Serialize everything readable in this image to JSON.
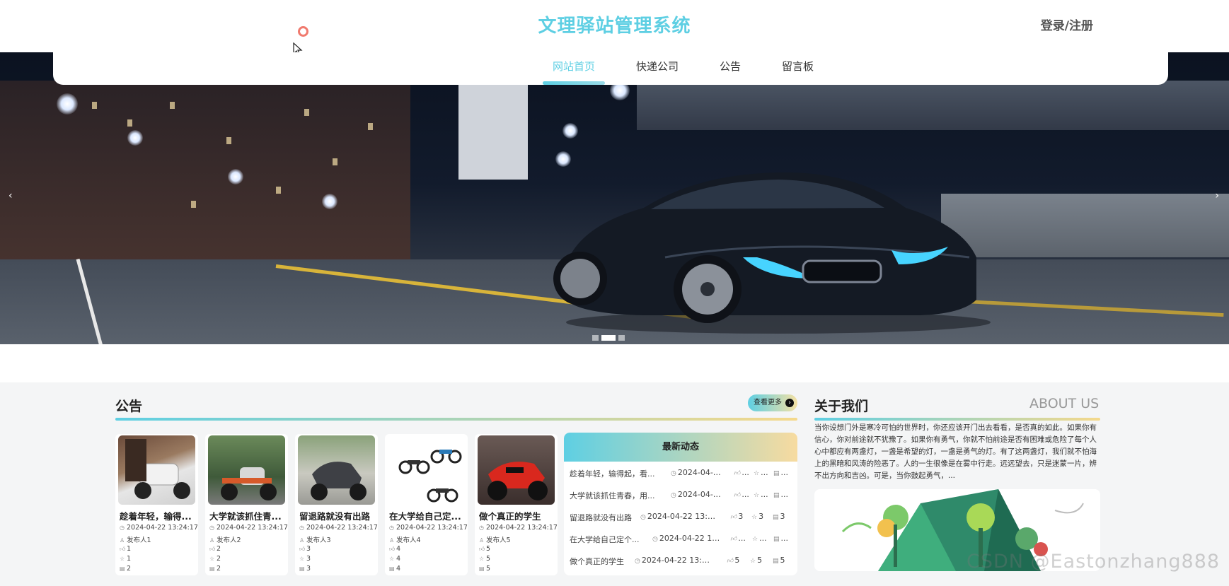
{
  "header": {
    "title": "文理驿站管理系统",
    "login_label": "登录/注册"
  },
  "nav": {
    "items": [
      {
        "label": "网站首页",
        "active": true
      },
      {
        "label": "快递公司",
        "active": false
      },
      {
        "label": "公告",
        "active": false
      },
      {
        "label": "留言板",
        "active": false
      }
    ]
  },
  "banner": {
    "prev_icon": "‹",
    "next_icon": "›",
    "slide_count": 3,
    "active_slide": 2
  },
  "notice": {
    "title": "公告",
    "more_label": "查看更多",
    "more_icon": "arrow-right-circle-icon",
    "cards": [
      {
        "title": "趁着年轻，输得...",
        "time": "2024-04-22 13:24:17",
        "publisher": "发布人1",
        "likes": "1",
        "favs": "1",
        "views": "2"
      },
      {
        "title": "大学就该抓住青...",
        "time": "2024-04-22 13:24:17",
        "publisher": "发布人2",
        "likes": "2",
        "favs": "2",
        "views": "2"
      },
      {
        "title": "留退路就没有出路",
        "time": "2024-04-22 13:24:17",
        "publisher": "发布人3",
        "likes": "3",
        "favs": "3",
        "views": "3"
      },
      {
        "title": "在大学给自己定...",
        "time": "2024-04-22 13:24:17",
        "publisher": "发布人4",
        "likes": "4",
        "favs": "4",
        "views": "4"
      },
      {
        "title": "做个真正的学生",
        "time": "2024-04-22 13:24:17",
        "publisher": "发布人5",
        "likes": "5",
        "favs": "5",
        "views": "5"
      }
    ]
  },
  "feed": {
    "title": "最新动态",
    "rows": [
      {
        "title": "趁着年轻，输得起，看...",
        "time": "2024-04-22...",
        "likes": "...",
        "favs": "...",
        "views": "..."
      },
      {
        "title": "大学就该抓住青春，用...",
        "time": "2024-04-22...",
        "likes": "...",
        "favs": "...",
        "views": "..."
      },
      {
        "title": "留退路就没有出路",
        "time": "2024-04-22 13:24:17",
        "likes": "3",
        "favs": "3",
        "views": "3"
      },
      {
        "title": "在大学给自己定个...",
        "time": "2024-04-22 13:2...",
        "likes": "...",
        "favs": "...",
        "views": "..."
      },
      {
        "title": "做个真正的学生",
        "time": "2024-04-22 13:24:17",
        "likes": "5",
        "favs": "5",
        "views": "5"
      }
    ]
  },
  "about": {
    "title": "关于我们",
    "title_en": "ABOUT US",
    "text": "当你设想门外是寒冷可怕的世界时，你还应该开门出去看看，是否真的如此。如果你有信心，你对前途就不犹豫了。如果你有勇气，你就不怕前途是否有困难或危险了每个人心中都应有两盏灯，一盏是希望的灯，一盏是勇气的灯。有了这两盏灯，我们就不怕海上的黑暗和风涛的险恶了。人的一生很像是在雾中行走。远远望去，只是迷蒙一片，辨不出方向和吉凶。可是，当你鼓起勇气，..."
  },
  "watermark": "CSDN @Eastonzhang888",
  "colors": {
    "accent": "#5ecfe3",
    "gradient_end": "#f5d98c",
    "section_bg": "#f4f5f6"
  }
}
